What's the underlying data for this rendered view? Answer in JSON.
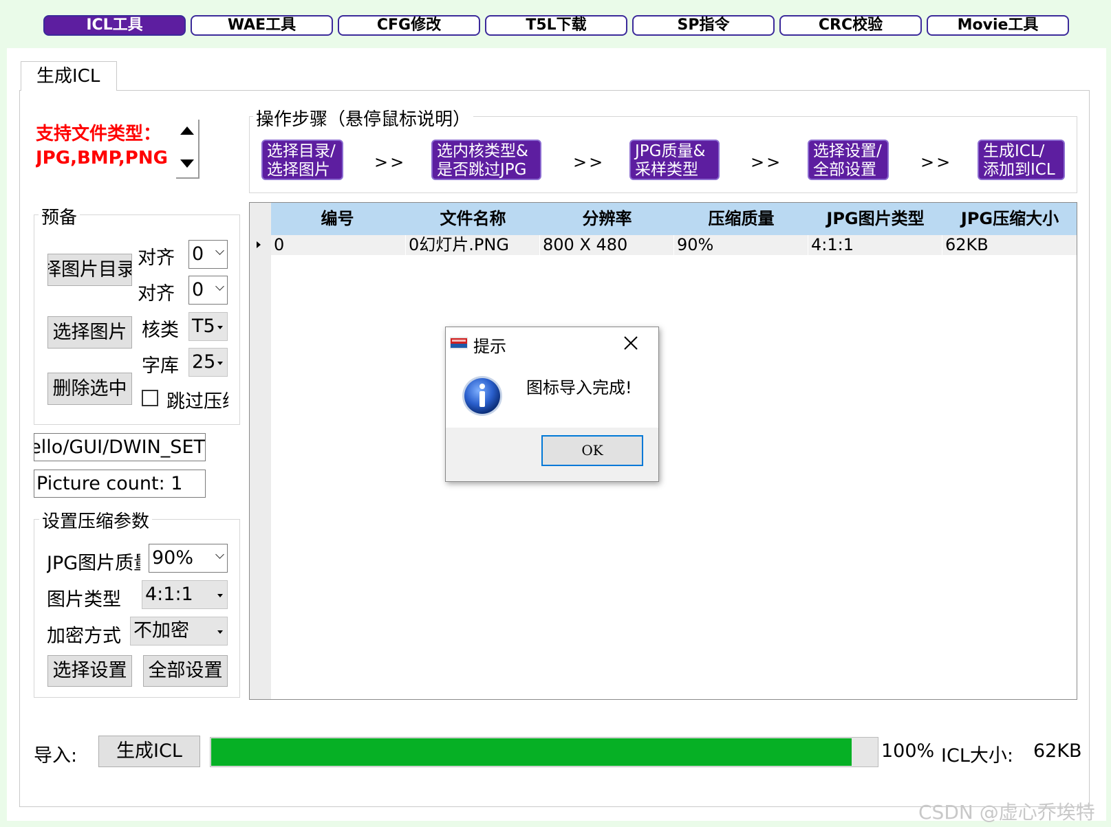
{
  "toolbar": {
    "tabs": [
      {
        "label": "ICL工具"
      },
      {
        "label": "WAE工具"
      },
      {
        "label": "CFG修改"
      },
      {
        "label": "T5L下载"
      },
      {
        "label": "SP指令"
      },
      {
        "label": "CRC校验"
      },
      {
        "label": "Movie工具"
      }
    ],
    "active_tab": "ICL工具"
  },
  "tab": {
    "title": "生成ICL"
  },
  "support": {
    "line1": "支持文件类型：",
    "line2": "JPG,BMP,PNG"
  },
  "steps": {
    "title": "操作步骤（悬停鼠标说明）",
    "separator": ">>",
    "items": [
      {
        "line1": "选择目录/",
        "line2": "选择图片"
      },
      {
        "line1": "选内核类型&",
        "line2": "是否跳过JPG"
      },
      {
        "line1": "JPG质量&",
        "line2": "采样类型"
      },
      {
        "line1": "选择设置/",
        "line2": "全部设置"
      },
      {
        "line1": "生成ICL/",
        "line2": "添加到ICL"
      }
    ]
  },
  "prep": {
    "legend": "预备",
    "select_dir_button": "择图片目录",
    "select_image_button": "选择图片",
    "delete_button": "删除选中",
    "align1_label": "对齐",
    "align1_value": "0",
    "align2_label": "对齐",
    "align2_value": "0",
    "core_label": "核类",
    "core_value": "T5",
    "font_label": "字库",
    "font_value": "25",
    "skip_label": "跳过压缩"
  },
  "path_field": "ello/GUI/DWIN_SET",
  "count_field": "Picture count: 1",
  "compress": {
    "legend": "设置压缩参数",
    "quality_label": "JPG图片质量",
    "quality_value": "90%",
    "type_label": "图片类型",
    "type_value": "4:1:1",
    "encrypt_label": "加密方式",
    "encrypt_value": "不加密",
    "select_settings_button": "选择设置",
    "all_settings_button": "全部设置"
  },
  "grid": {
    "columns": [
      "编号",
      "文件名称",
      "分辨率",
      "压缩质量",
      "JPG图片类型",
      "JPG压缩大小"
    ],
    "rows": [
      [
        "0",
        "0幻灯片.PNG",
        "800 X 480",
        "90%",
        "4:1:1",
        "62KB"
      ]
    ]
  },
  "bottom": {
    "import_label": "导入:",
    "generate_button": "生成ICL",
    "progress": 1.0,
    "progress_text": "100%",
    "size_label": "ICL大小:",
    "size_value": "62KB"
  },
  "dialog": {
    "title": "提示",
    "message": "图标导入完成!",
    "ok_label": "OK"
  },
  "watermark": "CSDN @虚心乔埃特",
  "colors": {
    "accent": "#5d1ea0",
    "progress": "#06b025",
    "header": "#bad9f2",
    "support_text": "#ff0000",
    "page_bg": "#eafbe9"
  }
}
